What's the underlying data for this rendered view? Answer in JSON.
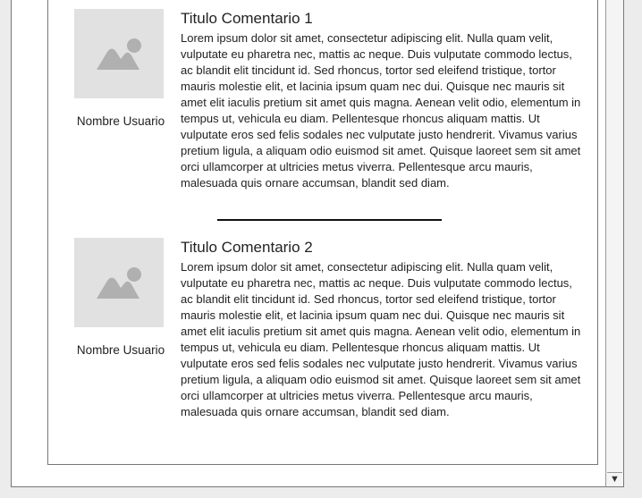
{
  "comments": [
    {
      "title": "Titulo Comentario 1",
      "user": "Nombre Usuario",
      "avatar_icon": "image-placeholder-icon",
      "body": "Lorem ipsum dolor sit amet, consectetur adipiscing elit. Nulla quam velit, vulputate eu pharetra nec, mattis ac neque. Duis vulputate commodo lectus, ac blandit elit tincidunt id. Sed rhoncus, tortor sed eleifend tristique, tortor mauris molestie elit, et lacinia ipsum quam nec dui. Quisque nec mauris sit amet elit iaculis pretium sit amet quis magna. Aenean velit odio, elementum in tempus ut, vehicula eu diam. Pellentesque rhoncus aliquam mattis. Ut vulputate eros sed felis sodales nec vulputate justo hendrerit. Vivamus varius pretium ligula, a aliquam odio euismod sit amet. Quisque laoreet sem sit amet orci ullamcorper at ultricies metus viverra. Pellentesque arcu mauris, malesuada quis ornare accumsan, blandit sed diam."
    },
    {
      "title": "Titulo Comentario 2",
      "user": "Nombre Usuario",
      "avatar_icon": "image-placeholder-icon",
      "body": "Lorem ipsum dolor sit amet, consectetur adipiscing elit. Nulla quam velit, vulputate eu pharetra nec, mattis ac neque. Duis vulputate commodo lectus, ac blandit elit tincidunt id. Sed rhoncus, tortor sed eleifend tristique, tortor mauris molestie elit, et lacinia ipsum quam nec dui. Quisque nec mauris sit amet elit iaculis pretium sit amet quis magna. Aenean velit odio, elementum in tempus ut, vehicula eu diam. Pellentesque rhoncus aliquam mattis. Ut vulputate eros sed felis sodales nec vulputate justo hendrerit. Vivamus varius pretium ligula, a aliquam odio euismod sit amet. Quisque laoreet sem sit amet orci ullamcorper at ultricies metus viverra. Pellentesque arcu mauris, malesuada quis ornare accumsan, blandit sed diam."
    }
  ],
  "scrollbar": {
    "down_arrow_icon": "arrow-down-icon"
  },
  "colors": {
    "placeholder_bg": "#e1e1e1",
    "placeholder_icon": "#b0b0b0"
  }
}
